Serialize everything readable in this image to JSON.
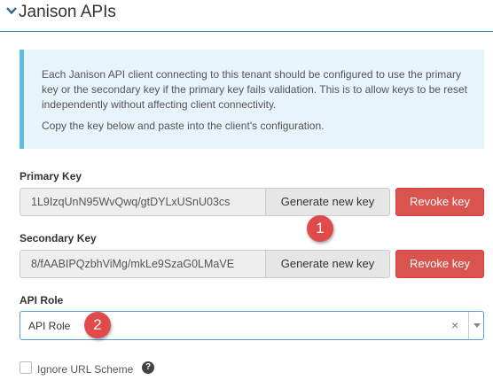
{
  "section": {
    "title": "Janison APIs",
    "chevron_icon": "chevron-down-icon"
  },
  "info": {
    "paragraph1": "Each Janison API client connecting to this tenant should be configured to use the primary key or the secondary key if the primary key fails validation. This is to allow keys to be reset independently without affecting client connectivity.",
    "paragraph2": "Copy the key below and paste into the client's configuration.",
    "accent_color": "#5bc0de"
  },
  "primary": {
    "label": "Primary Key",
    "value": "1L9IzqUnN95WvQwq/gtDYLxUSnU03cs",
    "generate_label": "Generate new key",
    "revoke_label": "Revoke key"
  },
  "secondary": {
    "label": "Secondary Key",
    "value": "8/fAABIPQzbhViMg/mkLe9SzaG0LMaVE",
    "generate_label": "Generate new key",
    "revoke_label": "Revoke key"
  },
  "api_role": {
    "label": "API Role",
    "selected": "API Role",
    "clear_glyph": "×"
  },
  "ignore_url": {
    "label": "Ignore URL Scheme",
    "checked": false,
    "help_glyph": "?"
  },
  "annotations": {
    "badge1": "1",
    "badge2": "2",
    "badge_color": "#e04a4a"
  },
  "colors": {
    "danger": "#d9534f",
    "focus_border": "#5b9dd9",
    "header_rule": "#3d7fb3"
  }
}
